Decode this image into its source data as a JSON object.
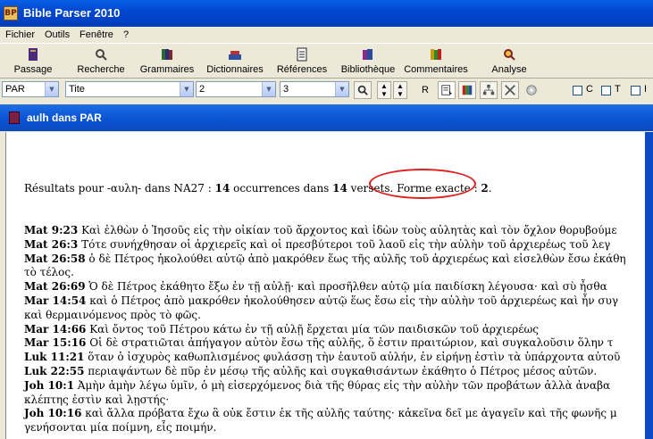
{
  "window": {
    "title": "Bible Parser 2010",
    "icon_label": "BP"
  },
  "menu": [
    "Fichier",
    "Outils",
    "Fenêtre",
    "?"
  ],
  "toolbar": [
    {
      "label": "Passage",
      "icon": "book-icon",
      "color": "#4a2a7a"
    },
    {
      "label": "Recherche",
      "icon": "magnifier-icon",
      "color": "#444444"
    },
    {
      "label": "Grammaires",
      "icon": "grammar-books-icon",
      "color": "#2a6a2a"
    },
    {
      "label": "Dictionnaires",
      "icon": "dictionary-icon",
      "color": "#c03030"
    },
    {
      "label": "Références",
      "icon": "references-icon",
      "color": "#222222"
    },
    {
      "label": "Bibliothèque",
      "icon": "library-icon",
      "color": "#8a2a8a"
    },
    {
      "label": "Commentaires",
      "icon": "commentary-icon",
      "color": "#c89a10"
    },
    {
      "label": "Analyse",
      "icon": "analysis-icon",
      "color": "#802020"
    }
  ],
  "selectors": {
    "version": "PAR",
    "book": "Tite",
    "chapter": "2",
    "verse": "3",
    "r_button": "R",
    "checkboxes": [
      "C",
      "T",
      "I"
    ]
  },
  "child": {
    "title": "aulh dans PAR",
    "summary": {
      "prefix": "Résultats pour -",
      "word": "αυλη",
      "mid1": "- dans NA27 : ",
      "occurrences": "14",
      "mid2": " occurrences dans ",
      "verses": "14",
      "mid3": " versets. ",
      "exact_label": "Forme exacte : ",
      "exact": "2",
      "end": "."
    },
    "lines": [
      {
        "ref": "Mat 9:23",
        "text": " Καὶ ἐλθὼν ὁ Ἰησοῦς εἰς τὴν οἰκίαν τοῦ ἄρχοντος καὶ ἰδὼν τοὺς αὐλητὰς καὶ τὸν ὄχλον θορυβούμε"
      },
      {
        "ref": "Mat 26:3",
        "text": " Τότε συνήχθησαν οἱ ἀρχιερεῖς καὶ οἱ πρεσβύτεροι τοῦ λαοῦ εἰς τὴν αὐλὴν τοῦ ἀρχιερέως τοῦ λεγ"
      },
      {
        "ref": "Mat 26:58",
        "text": " ὁ δὲ Πέτρος ἠκολούθει αὐτῷ ἀπὸ μακρόθεν ἕως τῆς αὐλῆς τοῦ ἀρχιερέως καὶ εἰσελθὼν ἔσω ἐκάθη"
      },
      {
        "ref": "",
        "text": "τὸ τέλος."
      },
      {
        "ref": "Mat 26:69",
        "text": " Ὁ δὲ Πέτρος ἐκάθητο ἔξω ἐν τῇ αὐλῇ· καὶ προσῆλθεν αὐτῷ μία παιδίσκη λέγουσα· καὶ σὺ ἦσθα"
      },
      {
        "ref": "Mar 14:54",
        "text": " καὶ ὁ Πέτρος ἀπὸ μακρόθεν ἠκολούθησεν αὐτῷ ἕως ἔσω εἰς τὴν αὐλὴν τοῦ ἀρχιερέως καὶ ἦν συγ"
      },
      {
        "ref": "",
        "text": "καὶ θερμαινόμενος πρὸς τὸ φῶς."
      },
      {
        "ref": "Mar 14:66",
        "text": " Καὶ ὄντος τοῦ Πέτρου κάτω ἐν τῇ αὐλῇ ἔρχεται μία τῶν παιδισκῶν τοῦ ἀρχιερέως"
      },
      {
        "ref": "Mar 15:16",
        "text": " Οἱ δὲ στρατιῶται ἀπήγαγον αὐτὸν ἔσω τῆς αὐλῆς, ὅ ἐστιν πραιτώριον, καὶ συγκαλοῦσιν ὅλην τ"
      },
      {
        "ref": "Luk 11:21",
        "text": " ὅταν ὁ ἰσχυρὸς καθωπλισμένος φυλάσσῃ τὴν ἑαυτοῦ αὐλήν, ἐν εἰρήνῃ ἐστὶν τὰ ὑπάρχοντα αὐτοῦ"
      },
      {
        "ref": "Luk 22:55",
        "text": " περιαψάντων δὲ πῦρ ἐν μέσῳ τῆς αὐλῆς καὶ συγκαθισάντων ἐκάθητο ὁ Πέτρος μέσος αὐτῶν."
      },
      {
        "ref": "Joh 10:1",
        "text": " Ἀμὴν ἀμὴν λέγω ὑμῖν, ὁ μὴ εἰσερχόμενος διὰ τῆς θύρας εἰς τὴν αὐλὴν τῶν προβάτων ἀλλὰ ἀναβα"
      },
      {
        "ref": "",
        "text": "κλέπτης ἐστὶν καὶ λῃστής·"
      },
      {
        "ref": "Joh 10:16",
        "text": " καὶ ἄλλα πρόβατα ἔχω ἃ οὐκ ἔστιν ἐκ τῆς αὐλῆς ταύτης· κἀκεῖνα δεῖ με ἀγαγεῖν καὶ τῆς φωνῆς μ"
      },
      {
        "ref": "",
        "text": "γενήσονται μία ποίμνη, εἷς ποιμήν."
      }
    ]
  },
  "colors": {
    "title_blue": "#0047d0",
    "highlight_red": "#e02020"
  }
}
